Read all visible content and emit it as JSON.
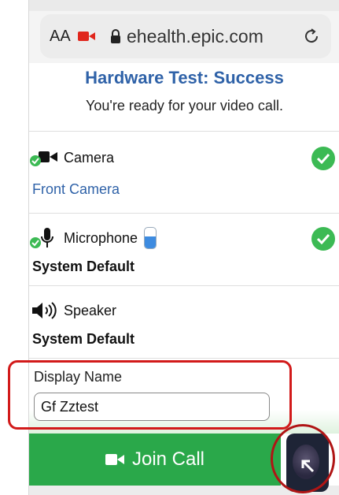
{
  "browser": {
    "aa_label": "AA",
    "url": "ehealth.epic.com"
  },
  "header": {
    "title": "Hardware Test: Success",
    "subtitle": "You're ready for your video call."
  },
  "devices": {
    "camera": {
      "label": "Camera",
      "value": "Front Camera"
    },
    "microphone": {
      "label": "Microphone",
      "value": "System Default"
    },
    "speaker": {
      "label": "Speaker",
      "value": "System Default"
    }
  },
  "display_name": {
    "label": "Display Name",
    "value": "Gf Zztest"
  },
  "join": {
    "label": "Join Call"
  },
  "colors": {
    "accent_blue": "#2f62a8",
    "success_green": "#3cba54",
    "join_green": "#2aa84a",
    "highlight_red": "#d21a1a"
  }
}
